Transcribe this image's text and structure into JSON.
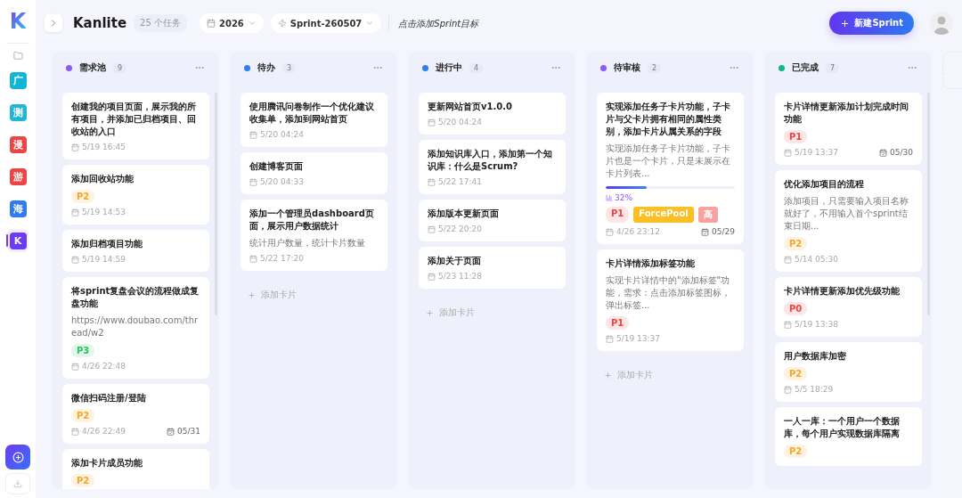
{
  "logo": "K",
  "sidebar": {
    "projects": [
      {
        "label": "广",
        "color": "#13b5d6",
        "selected": false
      },
      {
        "label": "测",
        "color": "#1fb6d9",
        "selected": false
      },
      {
        "label": "漫",
        "color": "#ef4444",
        "selected": false
      },
      {
        "label": "游",
        "color": "#ef4444",
        "selected": false
      },
      {
        "label": "海",
        "color": "#2f7cf0",
        "selected": false
      },
      {
        "label": "K",
        "color": "#6d3cf2",
        "selected": true
      }
    ]
  },
  "header": {
    "title": "Kanlite",
    "task_count": "25 个任务",
    "year": "2026",
    "sprint": "Sprint-260507",
    "sprint_goal_placeholder": "点击添加Sprint目标",
    "new_button": "新建Sprint"
  },
  "columns": [
    {
      "title": "需求池",
      "count": "9",
      "color": "#8b5cf6",
      "scrollbar": true,
      "cards": [
        {
          "title": "创建我的项目页面，展示我的所有项目，并添加已归档项目、回收站的入口",
          "created": "5/19 16:45"
        },
        {
          "title": "添加回收站功能",
          "tags": [
            {
              "label": "P2",
              "kind": "priority",
              "color": "#f5a623"
            }
          ],
          "created": "5/19 14:53"
        },
        {
          "title": "添加归档项目功能",
          "created": "5/19 14:59"
        },
        {
          "title": "将sprint复盘会议的流程做成复盘功能",
          "description": "https://www.doubao.com/thread/w2",
          "tags": [
            {
              "label": "P3",
              "kind": "priority",
              "color": "#22c55e"
            }
          ],
          "created": "4/26 22:48"
        },
        {
          "title": "微信扫码注册/登陆",
          "tags": [
            {
              "label": "P2",
              "kind": "priority",
              "color": "#f5a623"
            }
          ],
          "created": "4/26 22:49",
          "due": "05/31"
        },
        {
          "title": "添加卡片成员功能",
          "tags": [
            {
              "label": "P2",
              "kind": "priority",
              "color": "#f5a623"
            }
          ]
        }
      ]
    },
    {
      "title": "待办",
      "count": "3",
      "color": "#2f7cf0",
      "scrollbar": false,
      "add_card": "添加卡片",
      "cards": [
        {
          "title": "使用腾讯问卷制作一个优化建议收集单，添加到网站首页",
          "created": "5/20 04:24"
        },
        {
          "title": "创建博客页面",
          "created": "5/20 04:33"
        },
        {
          "title": "添加一个管理员dashboard页面，展示用户数据统计",
          "description": "统计用户数量，统计卡片数量",
          "created": "5/22 17:20"
        }
      ]
    },
    {
      "title": "进行中",
      "count": "4",
      "color": "#2f7cf0",
      "scrollbar": false,
      "add_card": "添加卡片",
      "cards": [
        {
          "title": "更新网站首页v1.0.0",
          "created": "5/20 04:24"
        },
        {
          "title": "添加知识库入口，添加第一个知识库：什么是Scrum?",
          "created": "5/22 17:41"
        },
        {
          "title": "添加版本更新页面",
          "created": "5/22 20:20"
        },
        {
          "title": "添加关于页面",
          "created": "5/23 11:28"
        }
      ]
    },
    {
      "title": "待审核",
      "count": "2",
      "color": "#8b5cf6",
      "scrollbar": false,
      "add_card": "添加卡片",
      "cards": [
        {
          "title": "实现添加任务子卡片功能，子卡片与父卡片拥有相同的属性类别，添加卡片从属关系的字段",
          "description": "实现添加任务子卡片功能，子卡片也是一个卡片，只是未展示在卡片列表...",
          "progress": {
            "level": 0.32,
            "label": "32%"
          },
          "tags": [
            {
              "label": "P1",
              "kind": "priority",
              "color": "#ef4444"
            },
            {
              "label": "ForcePool",
              "kind": "label",
              "color": "#fbbf24"
            },
            {
              "label": "高",
              "kind": "label",
              "color": "#f7a1a1"
            }
          ],
          "created": "4/26 23:12",
          "due": "05/29"
        },
        {
          "title": "卡片详情添加标签功能",
          "description": "实现卡片详情中的\"添加标签\"功能，需求：点击添加标签图标，弹出标签...",
          "tags": [
            {
              "label": "P1",
              "kind": "priority",
              "color": "#ef4444"
            }
          ],
          "created": "5/19 13:37"
        }
      ]
    },
    {
      "title": "已完成",
      "count": "7",
      "color": "#10b981",
      "scrollbar": true,
      "cards": [
        {
          "title": "卡片详情更新添加计划完成时间功能",
          "tags": [
            {
              "label": "P1",
              "kind": "priority",
              "color": "#ef4444"
            }
          ],
          "created": "5/19 13:37",
          "due": "05/30"
        },
        {
          "title": "优化添加项目的流程",
          "description": "添加项目，只需要输入项目名称就好了，不用输入首个sprint结束日期...",
          "tags": [
            {
              "label": "P2",
              "kind": "priority",
              "color": "#f5a623"
            }
          ],
          "created": "5/14 05:30"
        },
        {
          "title": "卡片详情更新添加优先级功能",
          "tags": [
            {
              "label": "P0",
              "kind": "priority",
              "color": "#ef4444"
            }
          ],
          "created": "5/19 13:38"
        },
        {
          "title": "用户数据库加密",
          "tags": [
            {
              "label": "P2",
              "kind": "priority",
              "color": "#f5a623"
            }
          ],
          "created": "5/5 18:29"
        },
        {
          "title": "一人一库：一个用户一个数据库，每个用户实现数据库隔离",
          "tags": [
            {
              "label": "P2",
              "kind": "priority",
              "color": "#f5a623"
            }
          ]
        }
      ]
    }
  ]
}
